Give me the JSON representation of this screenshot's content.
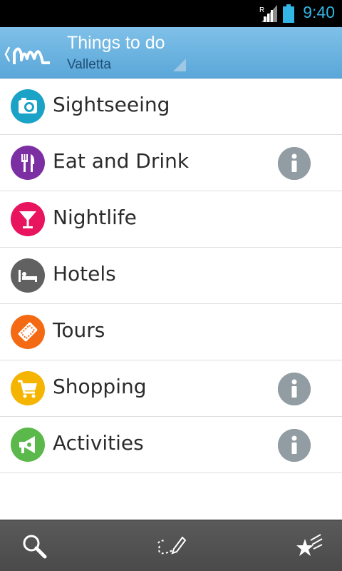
{
  "status_bar": {
    "time": "9:40",
    "signal_badge": "R"
  },
  "header": {
    "title": "Things to do",
    "subtitle": "Valletta"
  },
  "categories": [
    {
      "label": "Sightseeing",
      "color": "#1aa2c7",
      "icon": "camera-icon",
      "info": false
    },
    {
      "label": "Eat and Drink",
      "color": "#7b2fa3",
      "icon": "fork-knife-icon",
      "info": true
    },
    {
      "label": "Nightlife",
      "color": "#e8145e",
      "icon": "cocktail-glass-icon",
      "info": false
    },
    {
      "label": "Hotels",
      "color": "#616161",
      "icon": "bed-icon",
      "info": false
    },
    {
      "label": "Tours",
      "color": "#f46a12",
      "icon": "ticket-icon",
      "info": false
    },
    {
      "label": "Shopping",
      "color": "#f5b400",
      "icon": "shopping-cart-icon",
      "info": true
    },
    {
      "label": "Activities",
      "color": "#5bb84a",
      "icon": "megaphone-icon",
      "info": true
    }
  ],
  "bottom_bar": {
    "buttons": [
      "search-icon",
      "draw-route-icon",
      "favorites-stars-icon"
    ]
  },
  "colors": {
    "accent": "#33b5e5",
    "action_bar": "#6db4e0",
    "info_badge": "#919da3"
  }
}
